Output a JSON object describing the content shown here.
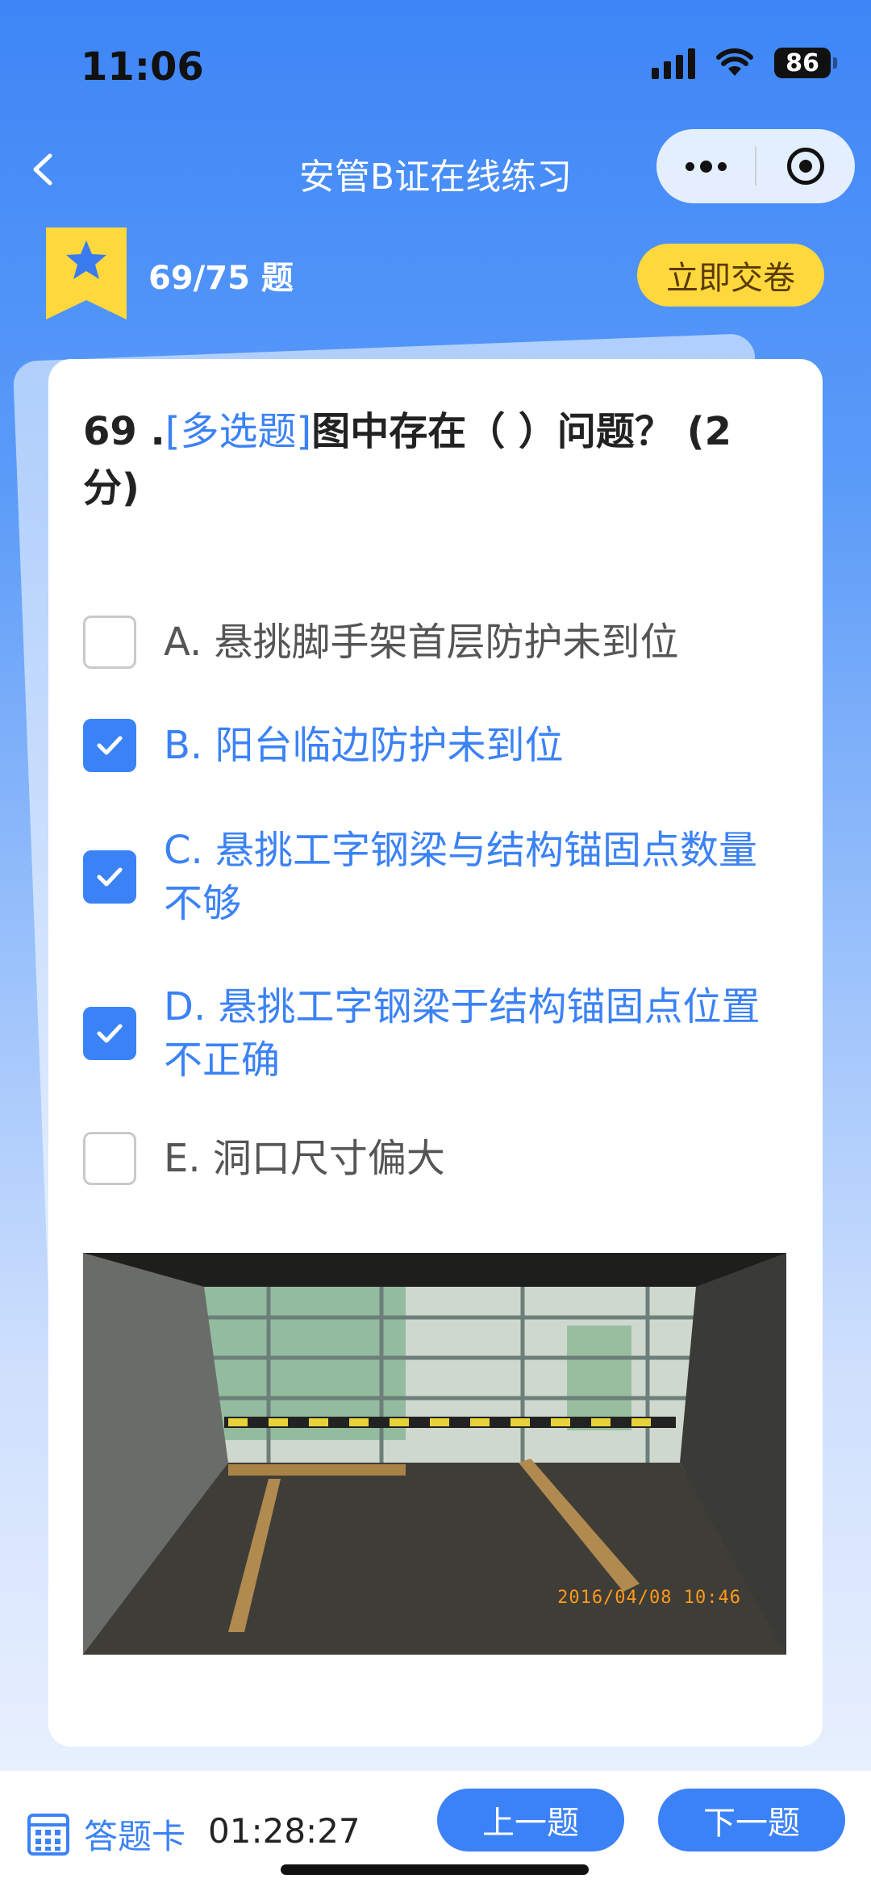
{
  "status": {
    "time": "11:06",
    "battery": "86"
  },
  "nav": {
    "title": "安管B证在线练习"
  },
  "progress": {
    "text": "69/75 题",
    "submit_label": "立即交卷"
  },
  "question": {
    "number": "69 .",
    "type": "[多选题]",
    "stem": "图中存在（ ）问题？ (2分)",
    "options": [
      {
        "text": "A. 悬挑脚手架首层防护未到位",
        "checked": false
      },
      {
        "text": "B. 阳台临边防护未到位",
        "checked": true
      },
      {
        "text": "C. 悬挑工字钢梁与结构锚固点数量不够",
        "checked": true
      },
      {
        "text": "D. 悬挑工字钢梁于结构锚固点位置不正确",
        "checked": true
      },
      {
        "text": "E. 洞口尺寸偏大",
        "checked": false
      }
    ],
    "photo_timestamp": "2016/04/08  10:46"
  },
  "bottom": {
    "answer_card_label": "答题卡",
    "timer": "01:28:27",
    "prev_label": "上一题",
    "next_label": "下一题"
  },
  "colors": {
    "accent": "#3b82f6",
    "submit": "#ffd83d",
    "ribbon": "#ffd83d"
  }
}
